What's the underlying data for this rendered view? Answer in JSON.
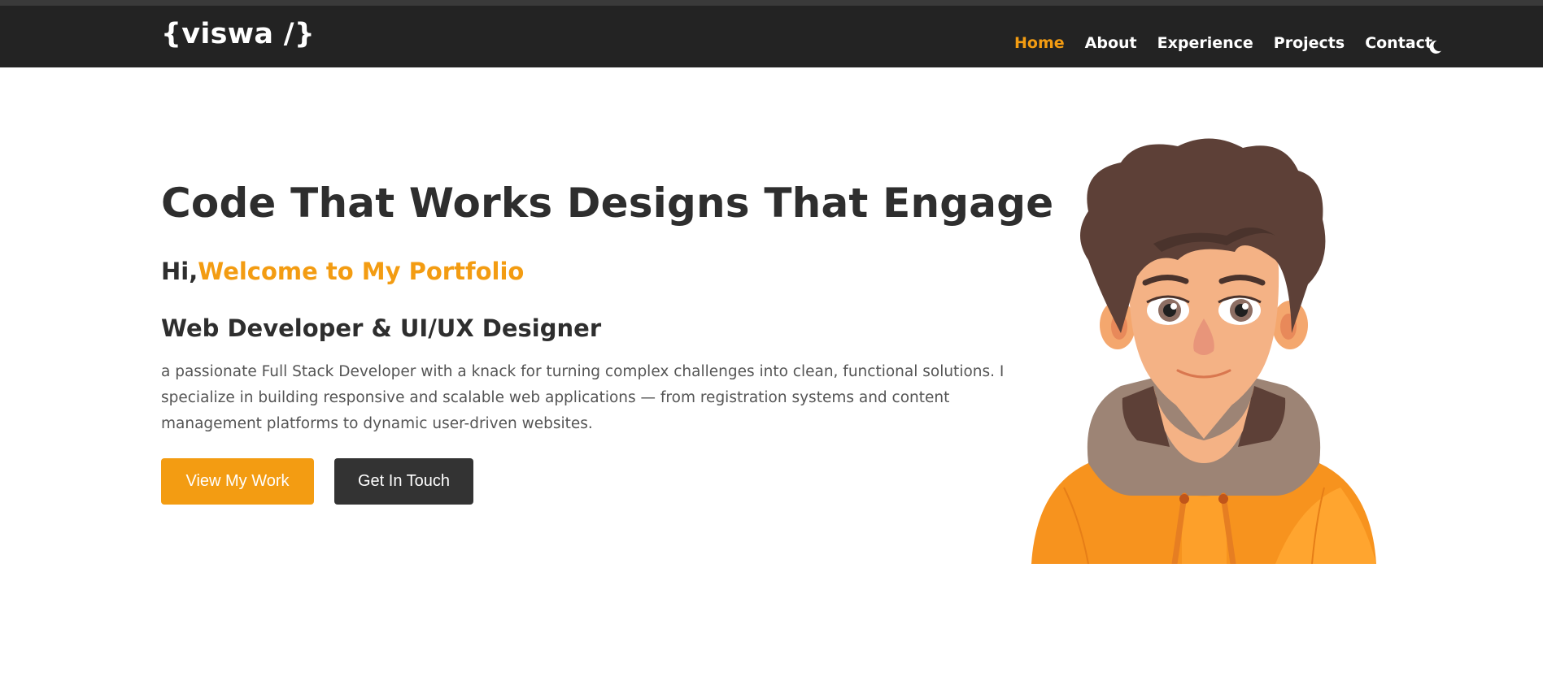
{
  "brand": {
    "logo_text": "{viswa /}"
  },
  "nav": {
    "items": [
      {
        "label": "Home",
        "active": true
      },
      {
        "label": "About",
        "active": false
      },
      {
        "label": "Experience",
        "active": false
      },
      {
        "label": "Projects",
        "active": false
      },
      {
        "label": "Contact",
        "active": false
      }
    ],
    "theme_icon": "moon-icon"
  },
  "hero": {
    "title": "Code That Works Designs That Engage",
    "greeting_prefix": "Hi,",
    "greeting_highlight": "Welcome to My Portfolio",
    "role": "Web Developer & UI/UX Designer",
    "description": "a passionate Full Stack Developer with a knack for turning complex challenges into clean, functional solutions. I specialize in building responsive and scalable web applications — from registration systems and content management platforms to dynamic user-driven websites.",
    "primary_button": "View My Work",
    "secondary_button": "Get In Touch",
    "avatar_icon": "developer-avatar-illustration"
  },
  "colors": {
    "accent": "#f39c12",
    "navbar_bg": "#232323",
    "dark_button": "#333333",
    "text": "#2e2e2e"
  }
}
